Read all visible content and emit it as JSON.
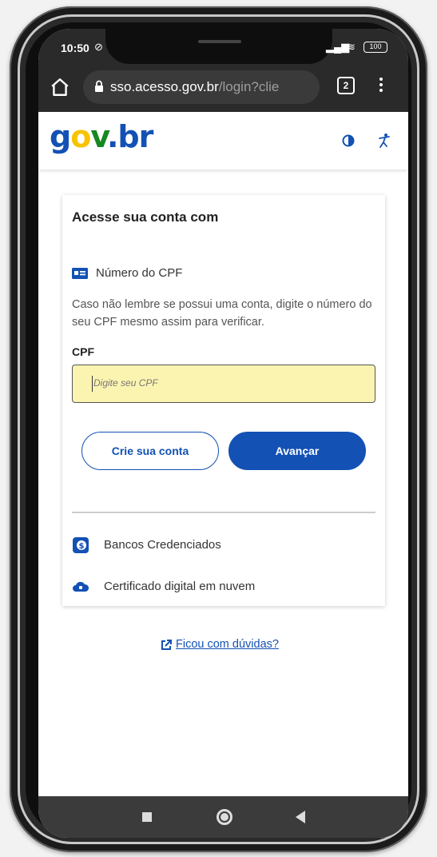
{
  "status": {
    "time": "10:50",
    "battery": "100"
  },
  "browser": {
    "url_host": "sso.acesso.gov.br",
    "url_path": "/login?clie",
    "tab_count": "2"
  },
  "header": {
    "logo": {
      "g": "g",
      "o": "o",
      "v": "v",
      "dot": ".",
      "br": "br"
    }
  },
  "card": {
    "title": "Acesse sua conta com",
    "cpf_option": "Número do CPF",
    "help_text": "Caso não lembre se possui uma conta, digite o número do seu CPF mesmo assim para verificar.",
    "field_label": "CPF",
    "input_placeholder": "Digite seu CPF",
    "create_account": "Crie sua conta",
    "advance": "Avançar",
    "alternatives": [
      {
        "label": "Bancos Credenciados",
        "icon": "bank-icon"
      },
      {
        "label": "Certificado digital em nuvem",
        "icon": "cloud-icon"
      }
    ]
  },
  "help_link": "Ficou com dúvidas?",
  "colors": {
    "primary": "#1351b4",
    "input_bg": "#fbf4b1"
  }
}
